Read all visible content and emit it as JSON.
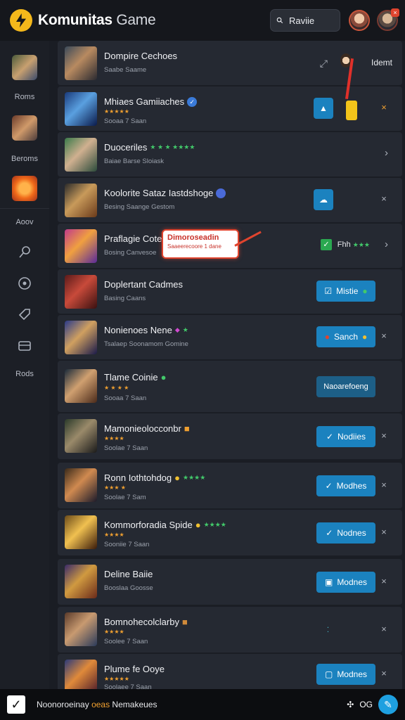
{
  "header": {
    "brand_bold": "Komunitas",
    "brand_light": " Game",
    "search_value": "Raviie"
  },
  "sidebar": {
    "labels": [
      "Roms",
      "Beroms",
      "Aoov",
      "Rods"
    ]
  },
  "rows": [
    {
      "title": "Dompire Cechoes",
      "sub": "Saabe Saame",
      "action": "Idemt",
      "kind": "idemt"
    },
    {
      "title": "Mhiaes Gamiiaches",
      "sub": "Sooaa 7 Saan",
      "stars": "★★★★★"
    },
    {
      "title": "Duoceriles",
      "sub": "Baiae Barse Sloiask",
      "gstars": "★ ★ ★ ★★★★"
    },
    {
      "title": "Koolorite Sataz Iastdshoge",
      "sub": "Besing Saange Gestom"
    },
    {
      "title": "Praflagie Cotes",
      "sub": "Bosing Canvesoe",
      "action": "Fhh",
      "callout": "Dimoroseadin",
      "callout_sub": "Saaeerecoore 1 dane"
    },
    {
      "title": "Doplertant Cadmes",
      "sub": "Basing Caans",
      "action": "Mistie"
    },
    {
      "title": "Nonienoes Nene",
      "sub": "Tsalaep Soonamom Gomine",
      "action": "Sanch"
    },
    {
      "title": "Tlame Coinie",
      "sub": "Sooaa 7 Saan",
      "action": "Naoarefoeng",
      "stars": "★ ★ ★ ★"
    },
    {
      "title": "Mamonieolocconbr",
      "sub": "Soolae 7 Saan",
      "action": "Nodiies",
      "stars": "★★★★"
    },
    {
      "title": "Ronn Iothtohdog",
      "sub": "Soolae 7 Sam",
      "action": "Modhes",
      "stars": "★★★ ★",
      "gstars": "★★★★"
    },
    {
      "title": "Kommorforadia Spide",
      "sub": "Sooniie 7 Saan",
      "action": "Nodnes",
      "stars": "★★★★",
      "gstars": "★★★★"
    },
    {
      "title": "Deline Baiie",
      "sub": "Booslaa Goosse",
      "action": "Modnes"
    },
    {
      "title": "Bomnohecolclarby",
      "sub": "Soolee 7 Saan",
      "stars": "★★★★"
    },
    {
      "title": "Plume fe Ooye",
      "sub": "Soolaee 7 Saan",
      "action": "Modnes",
      "stars": "★★★★★"
    }
  ],
  "footer": {
    "text_a": "Noonoroeinay ",
    "text_hl": "oeas",
    "text_b": " Nemakeues",
    "right": "OG"
  },
  "colors": {
    "accent": "#1b82bf",
    "brand": "#f4b81b",
    "alert": "#e0442e"
  }
}
